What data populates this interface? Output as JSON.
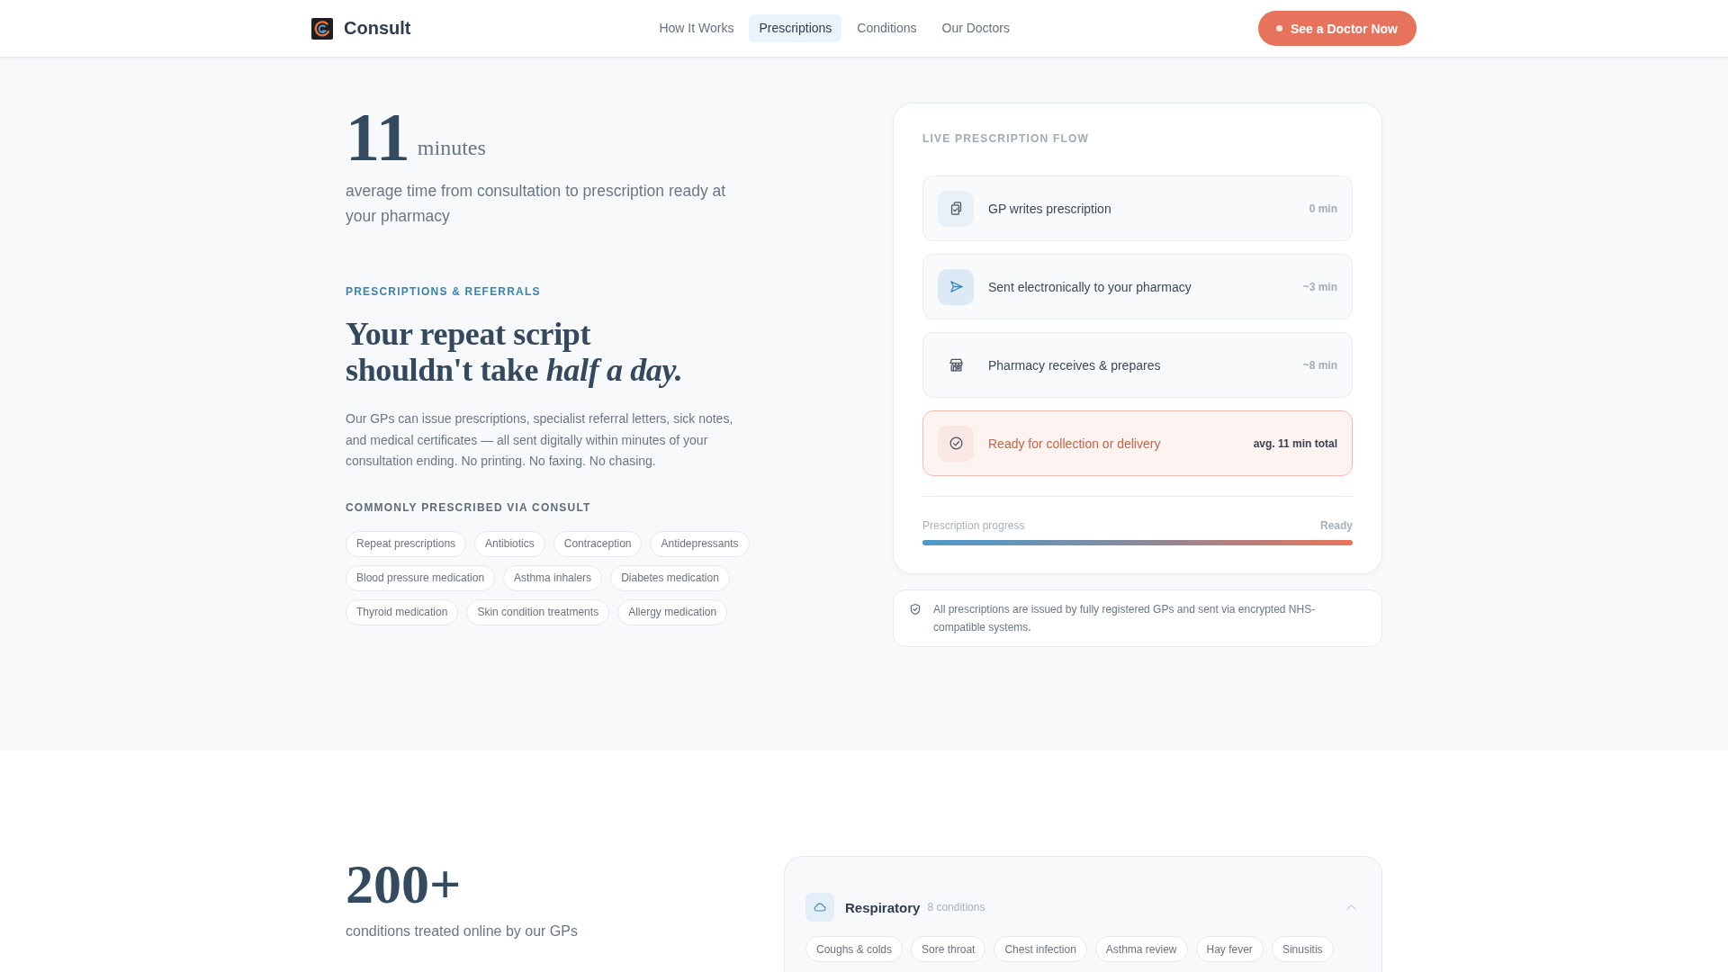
{
  "header": {
    "brand": "Consult",
    "nav": [
      {
        "label": "How It Works",
        "selected": false
      },
      {
        "label": "Prescriptions",
        "selected": true
      },
      {
        "label": "Conditions",
        "selected": false
      },
      {
        "label": "Our Doctors",
        "selected": false
      }
    ],
    "cta": "See a Doctor Now"
  },
  "hero": {
    "stat": {
      "value": "11",
      "unit": "minutes",
      "caption": "average time from consultation to prescription ready at your pharmacy"
    },
    "eyebrow": "PRESCRIPTIONS & REFERRALS",
    "heading": "Your repeat script shouldn't take *half a day.*",
    "body": "Our GPs can issue prescriptions, specialist referral letters, sick notes, and medical certificates — all sent digitally within minutes of your consultation ending. No printing. No faxing. No chasing.",
    "list_title": "COMMONLY PRESCRIBED VIA CONSULT",
    "tags": [
      "Repeat prescriptions",
      "Antibiotics",
      "Contraception",
      "Antidepressants",
      "Blood pressure medication",
      "Asthma inhalers",
      "Diabetes medication",
      "Thyroid medication",
      "Skin condition treatments",
      "Allergy medication"
    ]
  },
  "flow_card": {
    "title": "LIVE PRESCRIPTION FLOW",
    "steps": [
      {
        "label": "GP writes prescription",
        "time": "0 min",
        "kind": "done"
      },
      {
        "label": "Sent electronically to your pharmacy",
        "time": "~3 min",
        "kind": "active"
      },
      {
        "label": "Pharmacy receives & prepares",
        "time": "~8 min",
        "kind": "pending"
      },
      {
        "label": "Ready for collection or delivery",
        "time": "avg. 11 min total",
        "kind": "final"
      }
    ],
    "progress": {
      "label": "Prescription progress",
      "status": "Ready",
      "level": 1
    }
  },
  "notice": "All prescriptions are issued by fully registered GPs and sent via encrypted NHS-compatible systems.",
  "conditions": {
    "stat": {
      "value": "200+",
      "caption": "conditions treated online by our GPs"
    },
    "category": {
      "name": "Respiratory",
      "count": "8 conditions",
      "expanded": true,
      "tags": [
        "Coughs & colds",
        "Sore throat",
        "Chest infection",
        "Asthma review",
        "Hay fever",
        "Sinusitis"
      ]
    }
  }
}
